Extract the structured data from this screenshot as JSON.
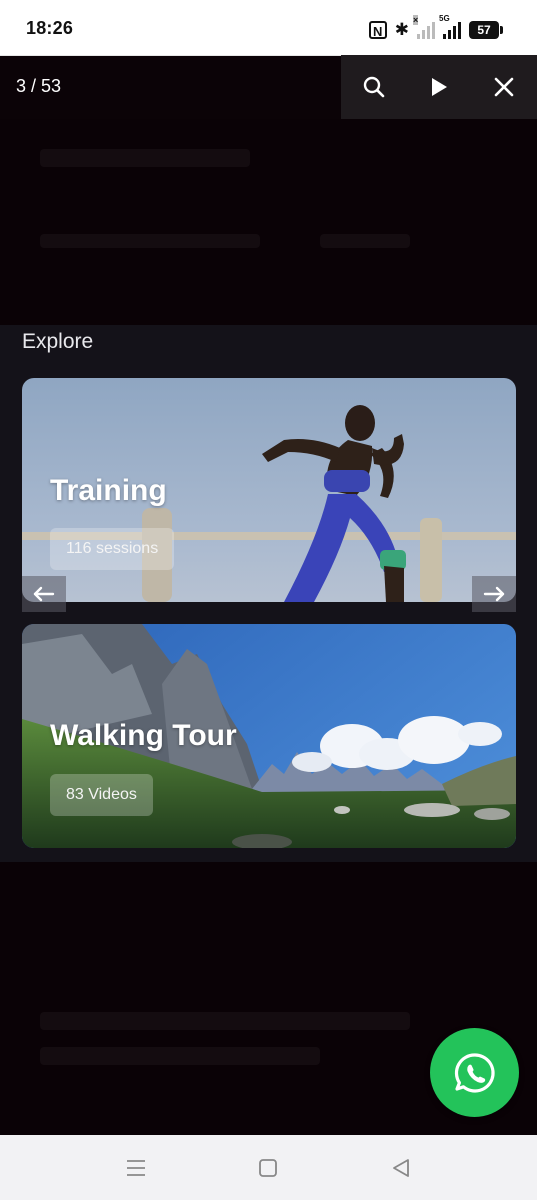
{
  "status_bar": {
    "time": "18:26",
    "nfc_label": "N",
    "bluetooth_glyph": "✱",
    "sim1_mark": "×",
    "sim2_mark": "5G",
    "battery": "57"
  },
  "viewer": {
    "counter": "3 / 53",
    "toolbar": {
      "search_icon": "search-icon",
      "play_icon": "play-icon",
      "close_icon": "close-icon"
    }
  },
  "explore": {
    "title": "Explore",
    "cards": [
      {
        "title": "Training",
        "badge": "116 sessions",
        "image": "woman-running-outdoors"
      },
      {
        "title": "Walking Tour",
        "badge": "83 Videos",
        "image": "mountain-meadow-landscape"
      }
    ],
    "prev_icon": "arrow-left-icon",
    "next_icon": "arrow-right-icon"
  },
  "fab": {
    "icon": "whatsapp-icon",
    "color": "#23c35a"
  },
  "nav_bar": {
    "menu_icon": "menu-icon",
    "home_icon": "home-square-icon",
    "back_icon": "back-triangle-icon"
  }
}
